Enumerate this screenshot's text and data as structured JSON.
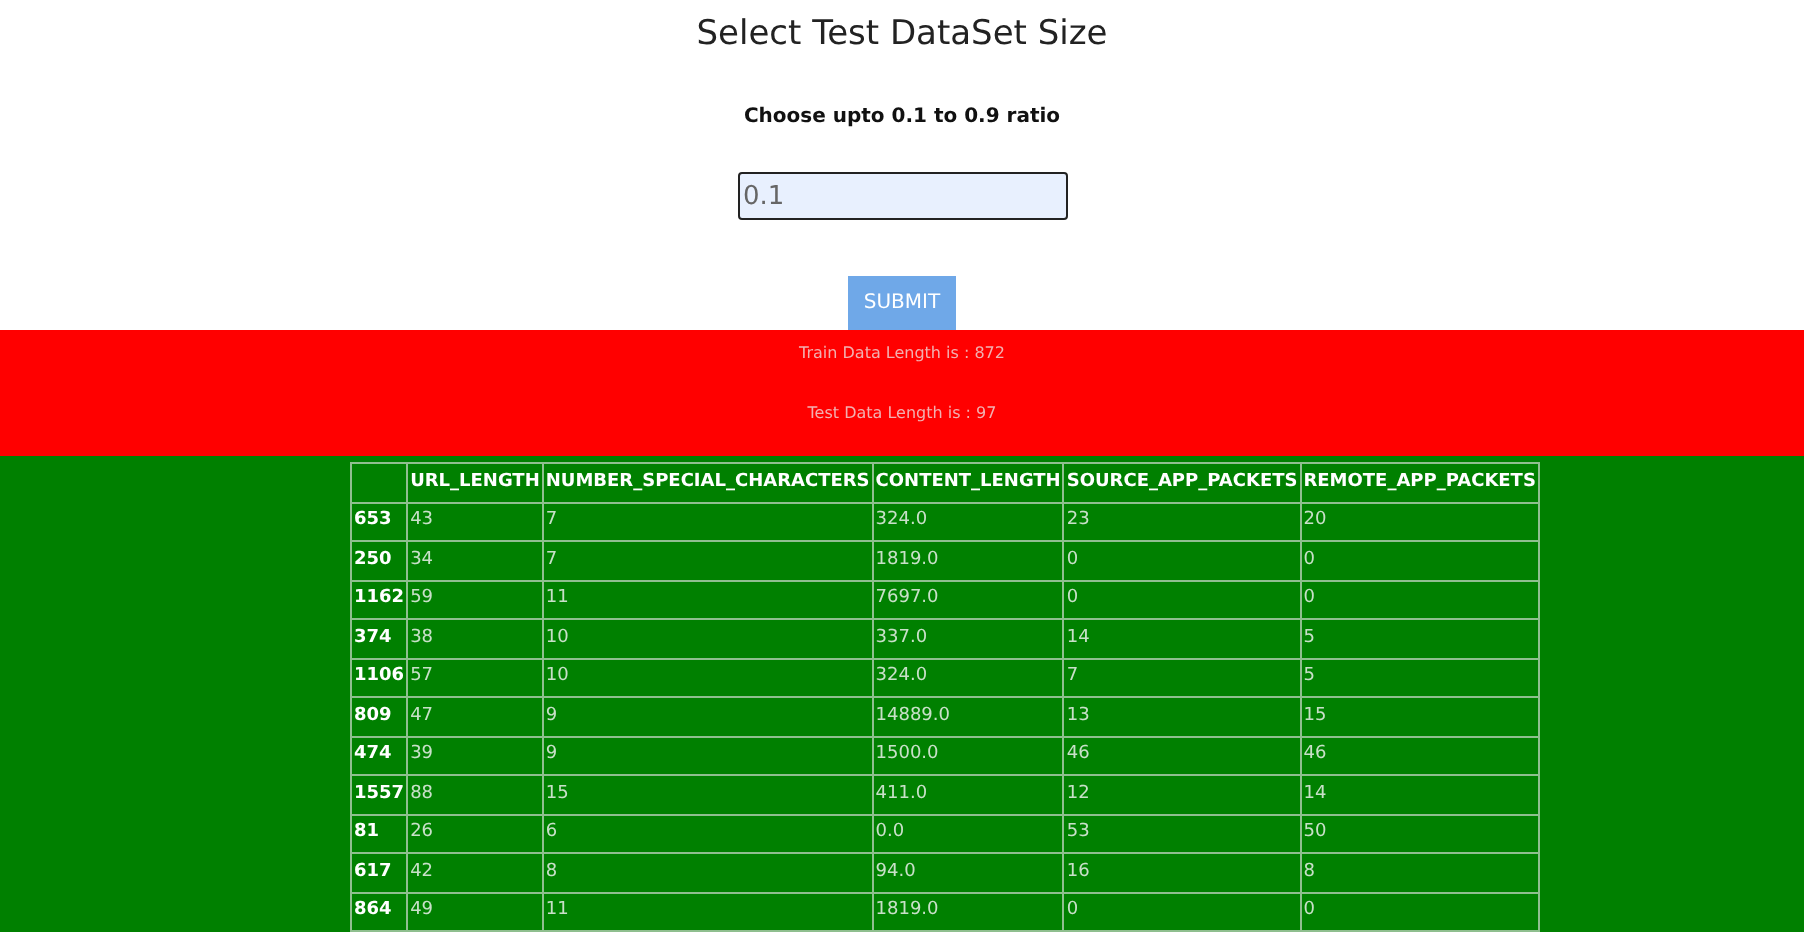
{
  "title": "Select Test DataSet Size",
  "prompt": "Choose upto 0.1 to 0.9 ratio",
  "ratio_field": {
    "value": "0.1"
  },
  "submit_button": "SUBMIT",
  "results": [
    "Train Data Length is : 872",
    "Test Data Length is : 97"
  ],
  "table": {
    "columns": [
      "",
      "URL_LENGTH",
      "NUMBER_SPECIAL_CHARACTERS",
      "CONTENT_LENGTH",
      "SOURCE_APP_PACKETS",
      "REMOTE_APP_PACKETS"
    ],
    "rows": [
      [
        "653",
        "43",
        "7",
        "324.0",
        "23",
        "20"
      ],
      [
        "250",
        "34",
        "7",
        "1819.0",
        "0",
        "0"
      ],
      [
        "1162",
        "59",
        "11",
        "7697.0",
        "0",
        "0"
      ],
      [
        "374",
        "38",
        "10",
        "337.0",
        "14",
        "5"
      ],
      [
        "1106",
        "57",
        "10",
        "324.0",
        "7",
        "5"
      ],
      [
        "809",
        "47",
        "9",
        "14889.0",
        "13",
        "15"
      ],
      [
        "474",
        "39",
        "9",
        "1500.0",
        "46",
        "46"
      ],
      [
        "1557",
        "88",
        "15",
        "411.0",
        "12",
        "14"
      ],
      [
        "81",
        "26",
        "6",
        "0.0",
        "53",
        "50"
      ],
      [
        "617",
        "42",
        "8",
        "94.0",
        "16",
        "8"
      ],
      [
        "864",
        "49",
        "11",
        "1819.0",
        "0",
        "0"
      ]
    ]
  }
}
